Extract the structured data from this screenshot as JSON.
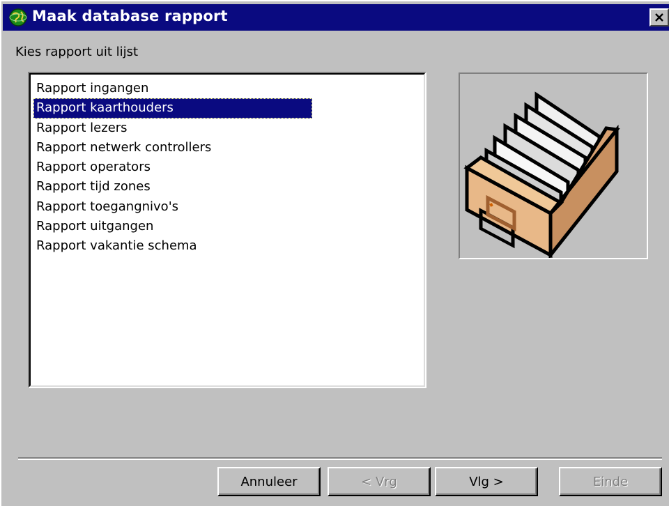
{
  "window": {
    "title": "Maak database rapport",
    "title_icon": "globe-icon",
    "close_icon": "close-icon"
  },
  "instruction": "Kies rapport uit lijst",
  "report_list": {
    "selected_index": 1,
    "items": [
      "Rapport ingangen",
      "Rapport kaarthouders",
      "Rapport lezers",
      "Rapport netwerk controllers",
      "Rapport operators",
      "Rapport tijd zones",
      "Rapport toegangnivo's",
      "Rapport uitgangen",
      "Rapport vakantie schema"
    ]
  },
  "illustration": {
    "icon": "card-file-box-icon"
  },
  "buttons": {
    "cancel": "Annuleer",
    "prev": "< Vrg",
    "next": "Vlg >",
    "finish": "Einde"
  },
  "colors": {
    "titlebar": "#0a0a80",
    "selection": "#0a0a80",
    "face": "#c0c0c0"
  }
}
